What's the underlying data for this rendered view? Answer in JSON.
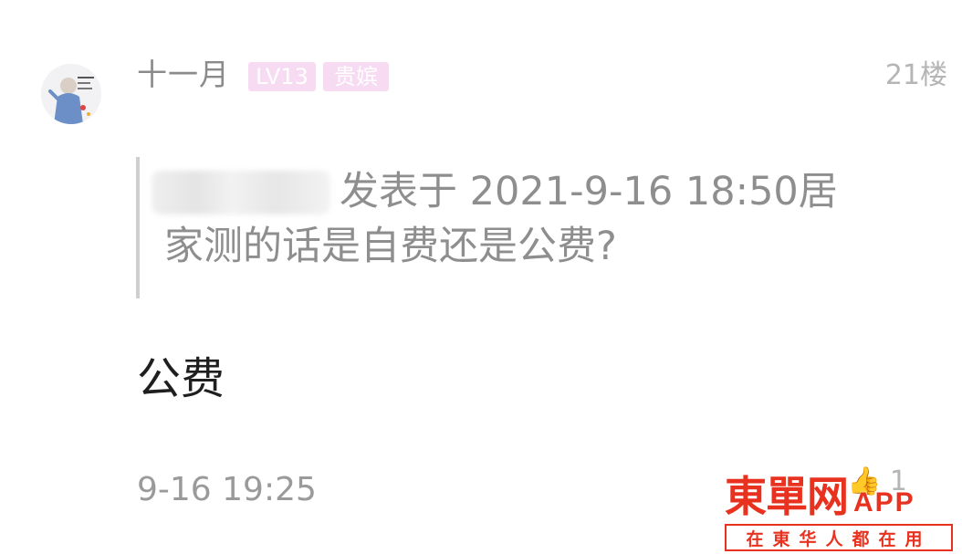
{
  "post": {
    "username": "十一月",
    "level_badge": "LV13",
    "title_badge": "贵嫔",
    "floor": "21楼",
    "quote": {
      "text_prefix": "发表于 2021-9-16 18:50居",
      "text_line2": "家测的话是自费还是公费?"
    },
    "reply": "公费",
    "time": "9-16 19:25",
    "likes": "1"
  },
  "watermark": {
    "brand": "東單网",
    "app": "APP",
    "slogan": "在東华人都在用"
  },
  "colors": {
    "badge_bg": "#f7dbf2",
    "brand_red": "#e8311e",
    "quote_bar": "#cfcfcf"
  },
  "icons": {
    "avatar": "avatar-image",
    "like": "thumb-up-icon"
  }
}
